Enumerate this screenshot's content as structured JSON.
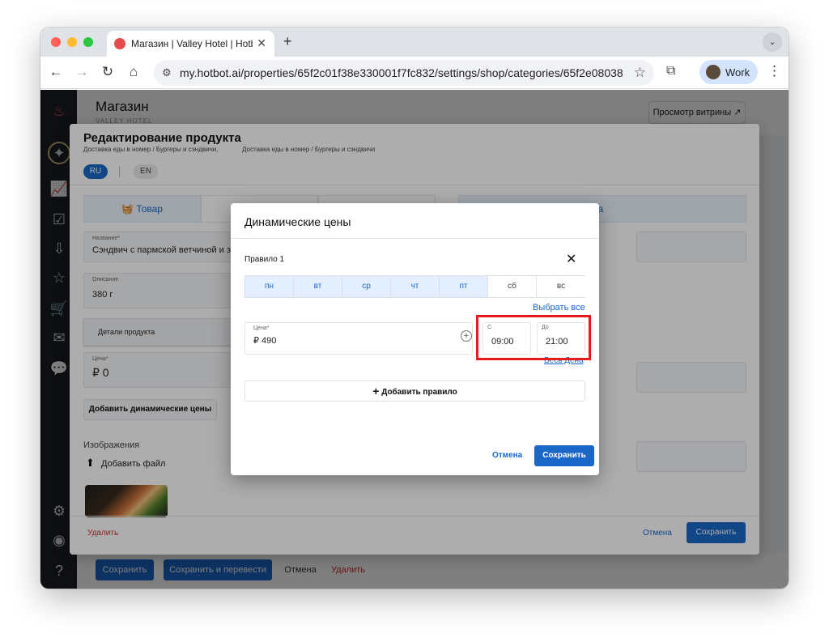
{
  "browser": {
    "tab_title": "Магазин | Valley Hotel | Hotbot",
    "tab_close": "✕",
    "new_tab": "+",
    "tab_menu": "⌄",
    "url": "my.hotbot.ai/properties/65f2c01f38e330001f7fc832/settings/shop/categories/65f2e08038...",
    "profile_label": "Work",
    "traffic_colors": [
      "#ff5f57",
      "#febc2e",
      "#28c840"
    ]
  },
  "page": {
    "title": "Магазин",
    "subtitle": "VALLEY HOTEL",
    "preview_button": "Просмотр витрины ↗",
    "bottom_save": "Сохранить",
    "bottom_save_translate": "Сохранить и перевести",
    "bottom_cancel": "Отмена",
    "bottom_delete": "Удалить",
    "sidebar_icons": [
      "flame-icon",
      "compass-icon",
      "chart-icon",
      "checklist-icon",
      "inbox-icon",
      "tray-icon",
      "cart-icon",
      "mail-icon",
      "chat-icon",
      "settings-icon",
      "user-icon",
      "help-icon"
    ]
  },
  "product_panel": {
    "title": "Редактирование продукта",
    "breadcrumb_1": "Доставка еды в номер / Бургеры и сэндвичи,",
    "breadcrumb_2": "Доставка еды в номер / Бургеры и сэндвичи",
    "lang_ru": "RU",
    "lang_en": "EN",
    "tab_product": "Товар",
    "tab_right_partial": "за",
    "name_label": "Название*",
    "name_value": "Сэндвич с пармской ветчиной и зел",
    "description_label": "Описание",
    "description_value": "380 г",
    "details_label": "Детали продукта",
    "price_label": "Цена*",
    "price_value": "₽ 0",
    "dynamic_prices_button": "Добавить динамические цены",
    "images_label": "Изображения",
    "add_file": "Добавить файл",
    "delete": "Удалить",
    "cancel": "Отмена",
    "save": "Сохранить"
  },
  "modal": {
    "title": "Динамические цены",
    "rule_label": "Правило 1",
    "days": [
      {
        "label": "пн",
        "selected": true
      },
      {
        "label": "вт",
        "selected": true
      },
      {
        "label": "ср",
        "selected": true
      },
      {
        "label": "чт",
        "selected": true
      },
      {
        "label": "пт",
        "selected": true
      },
      {
        "label": "сб",
        "selected": false
      },
      {
        "label": "вс",
        "selected": false
      }
    ],
    "select_all": "Выбрать все",
    "price_label": "Цена*",
    "price_value": "₽ 490",
    "from_label": "С",
    "from_value": "09:00",
    "to_label": "До",
    "to_value": "21:00",
    "whole_day": "Весь Дена",
    "add_rule": "Добавить правило",
    "cancel": "Отмена",
    "save": "Сохранить"
  },
  "colors": {
    "accent": "#1a67c8",
    "danger": "#d32f2f",
    "highlight": "#e61c1c",
    "sidebar": "#1c1f26"
  }
}
